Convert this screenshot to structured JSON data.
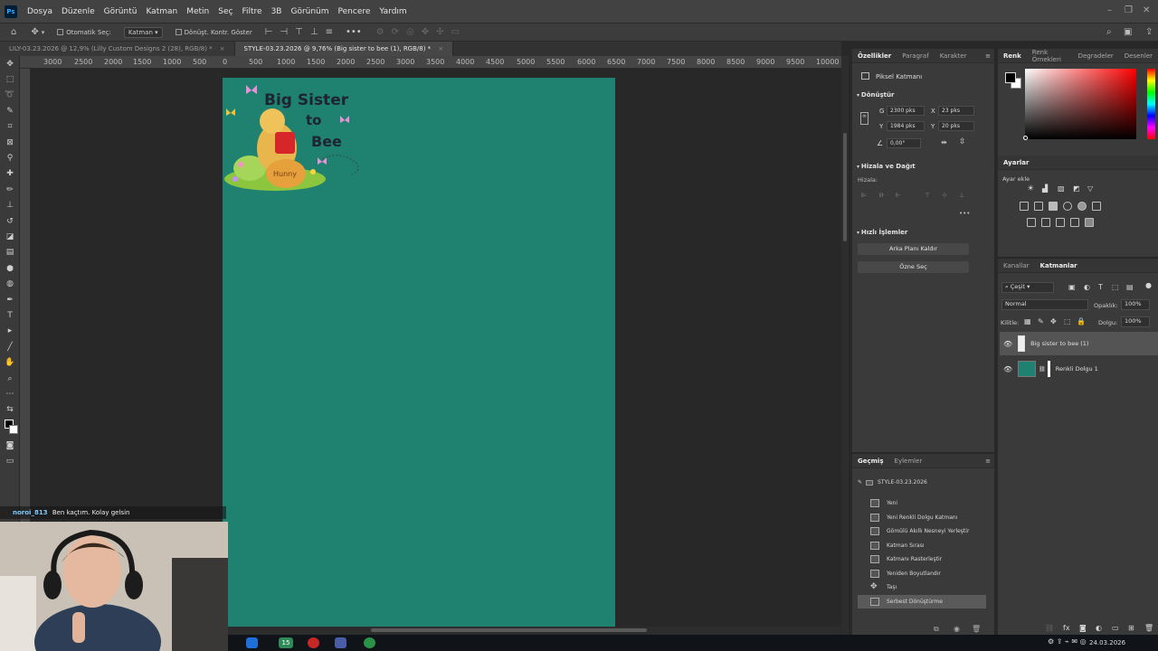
{
  "menubar": {
    "items": [
      "Dosya",
      "Düzenle",
      "Görüntü",
      "Katman",
      "Metin",
      "Seç",
      "Filtre",
      "3B",
      "Görünüm",
      "Pencere",
      "Yardım"
    ]
  },
  "options": {
    "auto_select_label": "Otomatik Seç:",
    "layer_dropdown": "Katman",
    "transform_controls_label": "Dönüşt. Kontr. Göster",
    "more_label": "•••"
  },
  "tabs": [
    {
      "label": "LILY-03.23.2026 @ 12,9% (Lilly Custom Designs 2 (28), RGB/8) *",
      "active": false
    },
    {
      "label": "STYLE-03.23.2026 @ 9,76% (Big sister to bee (1), RGB/8) *",
      "active": true
    }
  ],
  "ruler_ticks": [
    "3000",
    "2500",
    "2000",
    "1500",
    "1000",
    "500",
    "0",
    "500",
    "1000",
    "1500",
    "2000",
    "2500",
    "3000",
    "3500",
    "4000",
    "4500",
    "5000",
    "5500",
    "6000",
    "6500",
    "7000",
    "7500",
    "8000",
    "8500",
    "9000",
    "9500",
    "10000"
  ],
  "canvas": {
    "background_color": "#1f8170",
    "artwork": {
      "line1": "Big Sister",
      "line2": "to",
      "line3": "Bee",
      "honey_label": "Hunny"
    }
  },
  "properties": {
    "tabs": [
      "Özellikler",
      "Paragraf",
      "Karakter"
    ],
    "layer_type": "Piksel Katmanı",
    "transform_title": "Dönüştür",
    "w_label": "G",
    "w_value": "2300 pks",
    "x_label": "X",
    "x_value": "23 pks",
    "h_label": "Y",
    "h_value": "1984 pks",
    "y_label": "Y",
    "y_value": "20 pks",
    "angle_value": "0,00°",
    "align_title": "Hizala ve Dağıt",
    "align_sub": "Hizala:",
    "quick_title": "Hızlı İşlemler",
    "remove_bg_button": "Arka Planı Kaldır",
    "select_subject_button": "Özne Seç"
  },
  "history": {
    "tabs": [
      "Geçmiş",
      "Eylemler"
    ],
    "snapshot": "STYLE-03.23.2026",
    "items": [
      "Yeni",
      "Yeni Renkli Dolgu Katmanı",
      "Gömülü Akıllı Nesneyi Yerleştir",
      "Katman Sırası",
      "Katmanı Rasterleştir",
      "Yeniden Boyutlandır",
      "Taşı",
      "Serbest Dönüştürme"
    ],
    "selected_index": 7
  },
  "color_panel": {
    "tabs": [
      "Renk",
      "Renk Örnekleri",
      "Degradeler",
      "Desenler"
    ],
    "hue_color": "#ff0000"
  },
  "adjustments": {
    "title": "Ayarlar",
    "add_label": "Ayar ekle"
  },
  "layers_panel": {
    "tabs": [
      "Kanallar",
      "Katmanlar"
    ],
    "filter_label": "Çeşit",
    "blend_mode": "Normal",
    "opacity_label": "Opaklık:",
    "opacity_value": "100%",
    "lock_label": "Kilitle:",
    "fill_label": "Dolgu:",
    "fill_value": "100%",
    "layers": [
      {
        "name": "Big sister to bee (1)",
        "selected": true
      },
      {
        "name": "Renkli Dolgu 1",
        "selected": false,
        "fill_color": "#1f8170"
      }
    ]
  },
  "chat": {
    "user": "noroi_813",
    "message": "Ben kaçtım. Kolay gelsin"
  },
  "taskbar": {
    "badge": "15",
    "date": "24.03.2026"
  }
}
